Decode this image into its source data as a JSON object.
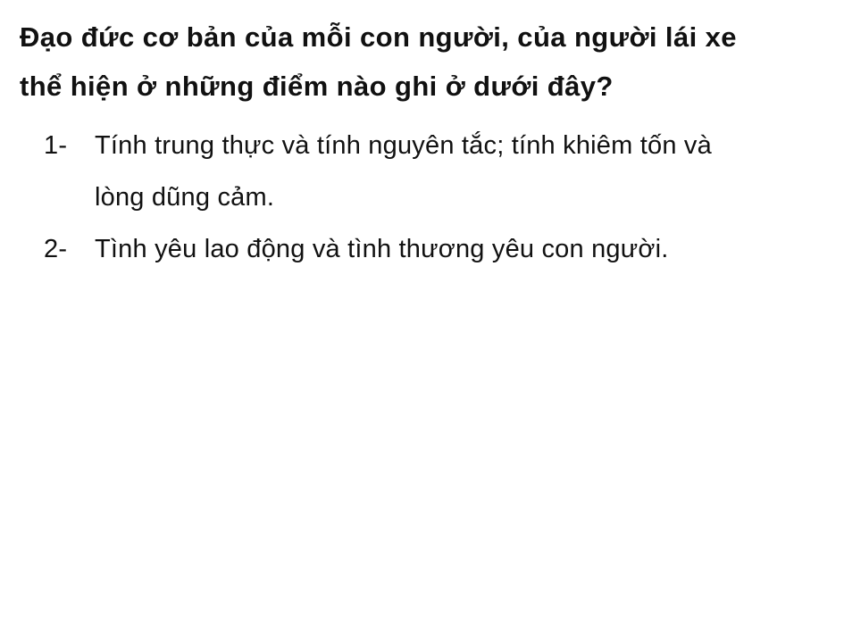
{
  "question": {
    "lines": [
      "Đạo đức cơ bản của mỗi con người, của người lái xe",
      "thể hiện ở những điểm nào ghi ở dưới đây?"
    ]
  },
  "answers": [
    {
      "number": "1-",
      "lines": [
        "Tính trung thực và tính nguyên tắc; tính khiêm tốn và",
        "lòng dũng cảm."
      ]
    },
    {
      "number": "2-",
      "lines": [
        "Tình yêu lao động và tình thương yêu con người."
      ]
    }
  ]
}
